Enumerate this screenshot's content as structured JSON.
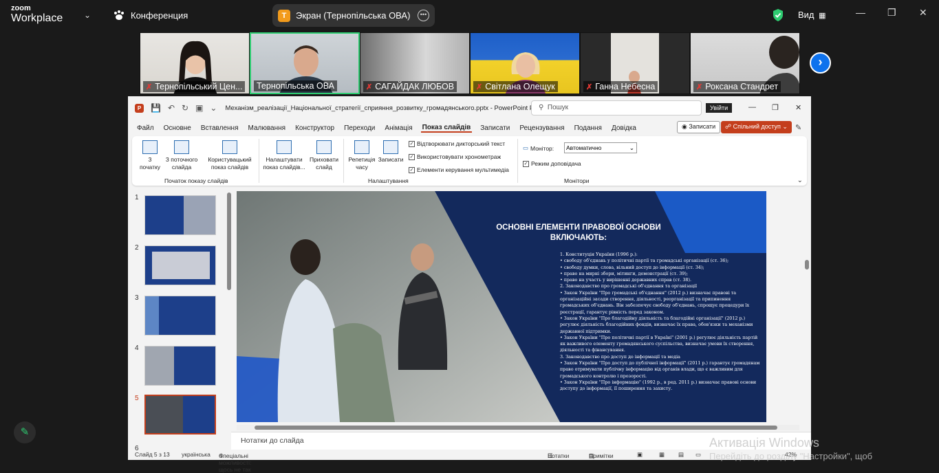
{
  "zoom": {
    "logo_small": "zoom",
    "logo_big": "Workplace",
    "meeting_label": "Конференция",
    "share_badge": "T",
    "share_title": "Экран (Тернопільська ОВА)",
    "view_label": "Вид",
    "colors": {
      "accent": "#0e72ed",
      "active_speaker": "#2ecc71",
      "badge": "#f29b1c"
    }
  },
  "participants": [
    {
      "name": "Тернопільський Цен...",
      "muted": true
    },
    {
      "name": "Тернопільська ОВА",
      "muted": false,
      "active": true
    },
    {
      "name": "САГАЙДАК ЛЮБОВ",
      "muted": true
    },
    {
      "name": "Світлана Олещук",
      "muted": true
    },
    {
      "name": "Ганна Небесна",
      "muted": true
    },
    {
      "name": "Роксана Стандрет",
      "muted": true
    }
  ],
  "ppt": {
    "filename": "Механізм_реалізації_Національної_стратегії_сприяння_розвитку_громадянського.pptx  -  PowerPoint Pr...",
    "search_placeholder": "Пошук",
    "signin": "Увійти",
    "menu": [
      "Файл",
      "Основне",
      "Вставлення",
      "Малювання",
      "Конструктор",
      "Переходи",
      "Анімація",
      "Показ слайдів",
      "Записати",
      "Рецензування",
      "Подання",
      "Довідка"
    ],
    "active_menu": "Показ слайдів",
    "record_btn": "Записати",
    "share_btn": "Спільний доступ",
    "ribbon": {
      "from_start": "З початку",
      "from_current": "З поточного слайда",
      "custom": "Користувацький показ слайдів",
      "group_start": "Початок показу слайдів",
      "setup": "Налаштувати показ слайдів...",
      "hide": "Приховати слайд",
      "rehearse": "Репетиція часу",
      "record": "Записати",
      "chk_narration": "Відтворювати дикторський текст",
      "chk_timings": "Використовувати хронометраж",
      "chk_media": "Елементи керування мультимедіа",
      "group_setup": "Налаштування",
      "monitor_label": "Монітор:",
      "monitor_value": "Автоматично",
      "presenter_view": "Режим доповідача",
      "group_monitors": "Монітори"
    },
    "thumb_numbers": [
      "1",
      "2",
      "3",
      "4",
      "5",
      "6"
    ],
    "selected_slide": "5",
    "slide": {
      "title": "ОСНОВНІ ЕЛЕМЕНТИ ПРАВОВОЇ ОСНОВИ ВКЛЮЧАЮТЬ:",
      "body": [
        "1. Конституція України (1996 р.):",
        "• свободу об'єднань у політичні партії та громадські організації (ст. 36);",
        "• свободу думки, слова, вільний доступ до інформації (ст. 34);",
        "• право на мирні збори, мітинги, демонстрації (ст. 39);",
        "• право на участь у вирішенні державних справ (ст. 38).",
        "2. Законодавство про громадські об'єднання та організації",
        "• Закон України \"Про громадські об'єднання\" (2012 р.) визначає правові та організаційні засади створення, діяльності, реорганізації та припинення громадських об'єднань. Він забезпечує свободу об'єднань, спрощує процедури їх реєстрації, гарантує рівність перед законом.",
        "• Закон України \"Про благодійну діяльність та благодійні організації\" (2012 р.) регулює діяльність благодійних фондів, визначає їх права, обов'язки та механізми державної підтримки.",
        "• Закон України \"Про політичні партії в Україні\" (2001 р.) регулює діяльність партій як важливого елементу громадянського суспільства, визначає умови їх створення, діяльності та фінансування.",
        "3. Законодавство про доступ до інформації та медіа",
        "• Закон України \"Про доступ до публічної інформації\" (2011 р.) гарантує громадянам право отримувати публічну інформацію від органів влади, що є важливим для громадського контролю і прозорості.",
        "• Закон України \"Про інформацію\" (1992 р., в ред. 2011 р.) визначає правові основи доступу до інформації, її поширення та захисту."
      ]
    },
    "notes_placeholder": "Нотатки до слайда",
    "status": {
      "slide_of": "Слайд 5 з 13",
      "language": "українська",
      "accessibility": "Спеціальні можливості: щось не так",
      "notes": "Нотатки",
      "comments": "Примітки",
      "zoom": "42%"
    }
  },
  "os": {
    "activate_title": "Активація Windows",
    "activate_sub": "Перейдіть до розділу \"Настройки\", щоб"
  }
}
